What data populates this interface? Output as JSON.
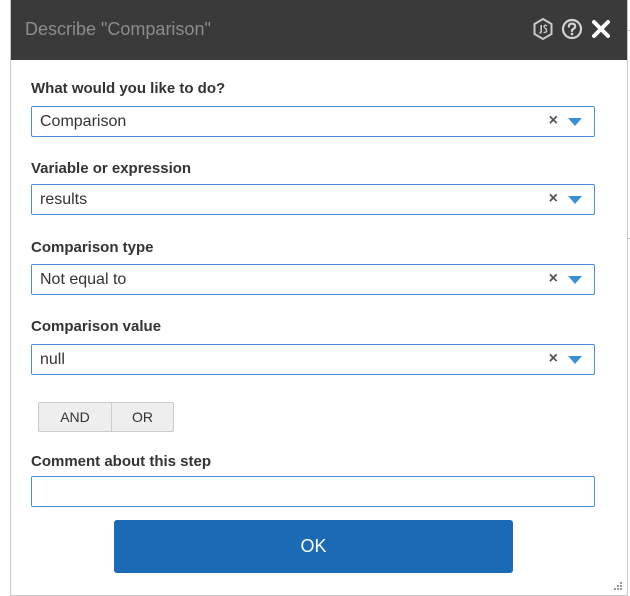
{
  "dialog": {
    "title": "Describe \"Comparison\"",
    "icons": [
      "js-icon",
      "help-icon",
      "close-icon"
    ]
  },
  "fields": [
    {
      "label": "What would you like to do?",
      "value": "Comparison"
    },
    {
      "label": "Variable or expression",
      "value": "results"
    },
    {
      "label": "Comparison type",
      "value": "Not equal to"
    },
    {
      "label": "Comparison value",
      "value": "null"
    }
  ],
  "clear_glyph": "×",
  "logic_buttons": {
    "and_label": "AND",
    "or_label": "OR"
  },
  "comment": {
    "label": "Comment about this step",
    "value": ""
  },
  "ok_label": "OK",
  "colors": {
    "titlebar": "#3a3a3a",
    "title_text": "#8c8c8c",
    "accent": "#1a6ab5",
    "input_border": "#4a90d9",
    "dropdown_arrow": "#3b8fd6"
  }
}
